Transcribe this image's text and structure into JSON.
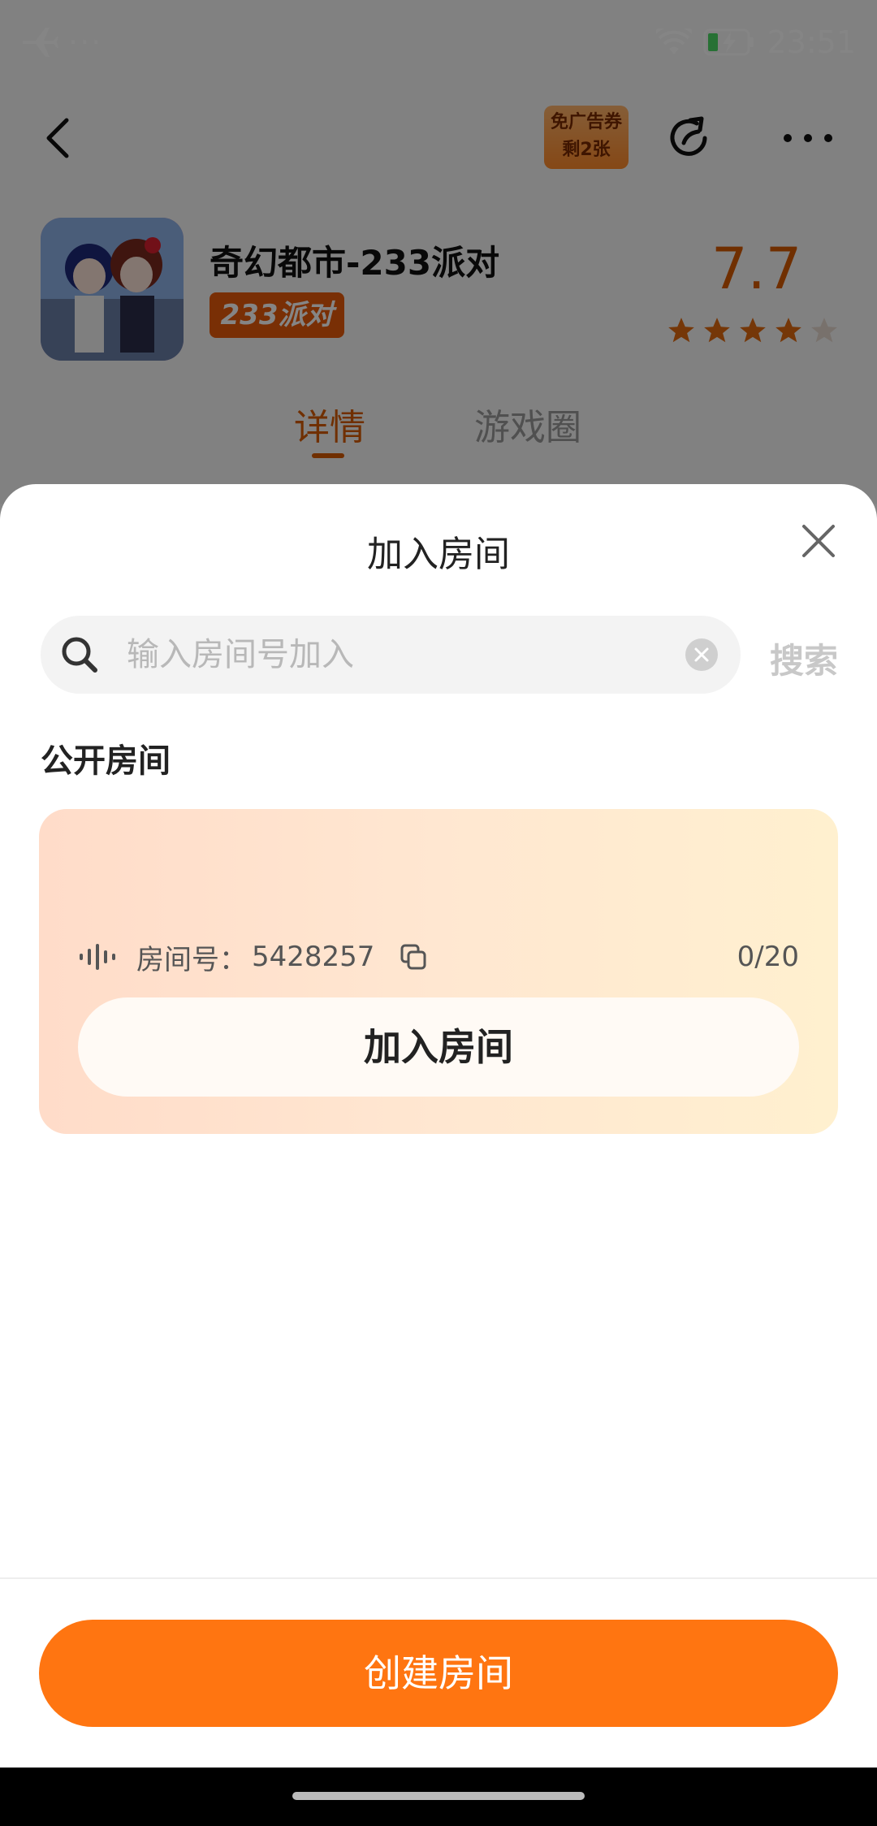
{
  "status_bar": {
    "time": "23:51",
    "left_icons": [
      "airplane-icon",
      "more-dots"
    ],
    "dots": "···",
    "right_icons": [
      "wifi-icon",
      "battery-charging-icon"
    ]
  },
  "app_header": {
    "coupon_line1": "免广告券",
    "coupon_line2": "剩2张"
  },
  "game": {
    "title": "奇幻都市-233派对",
    "tag": "233派对",
    "rating": "7.7",
    "stars_filled": 4,
    "stars_total": 5
  },
  "tabs": [
    {
      "label": "详情",
      "active": true
    },
    {
      "label": "游戏圈",
      "active": false
    }
  ],
  "sheet": {
    "title": "加入房间",
    "search": {
      "placeholder": "输入房间号加入",
      "value": "",
      "button_label": "搜索"
    },
    "section_title": "公开房间",
    "rooms": [
      {
        "label": "房间号：",
        "number": "5428257",
        "count": "0/20",
        "join_label": "加入房间"
      }
    ],
    "create_label": "创建房间"
  },
  "colors": {
    "accent": "#ff7511",
    "rating": "#d65a00",
    "card_gradient_start": "#ffdcc9",
    "card_gradient_end": "#fff0cf"
  }
}
